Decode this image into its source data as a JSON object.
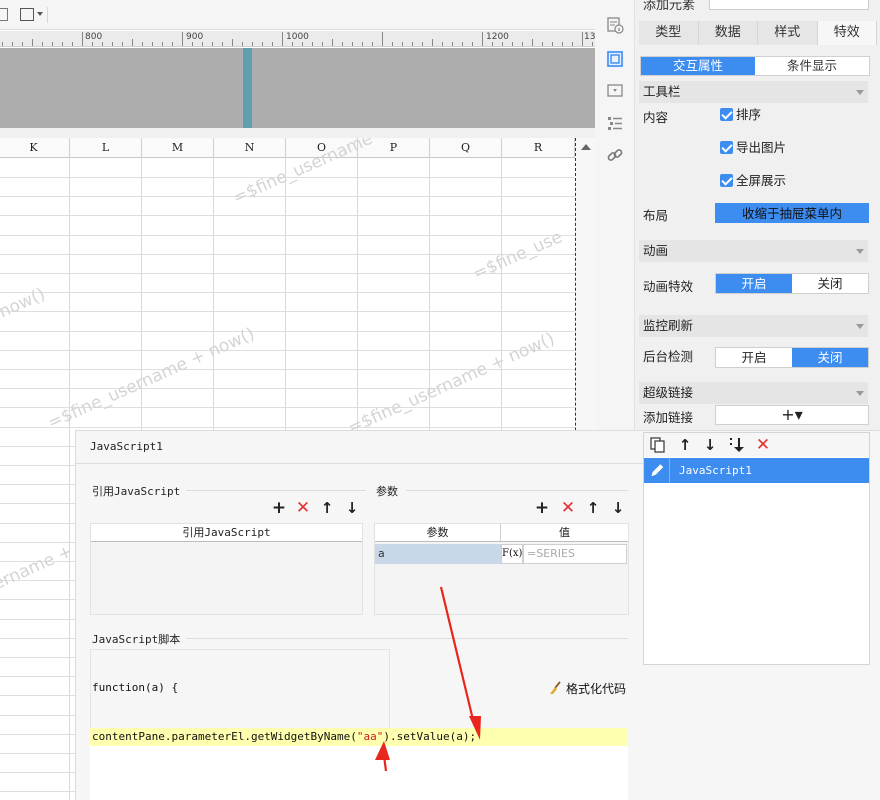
{
  "ruler": {
    "marks": [
      "800",
      "900",
      "1000",
      "1200",
      "13"
    ]
  },
  "sheet": {
    "columns": [
      "K",
      "L",
      "M",
      "N",
      "O",
      "P",
      "Q",
      "R"
    ],
    "watermark_text": "=$fine_username + now()",
    "watermarks": [
      "=$fine_username",
      "=$fine_use",
      "=$fine_username + now()",
      "=$fine_username + now()",
      "now()",
      "ername + now()"
    ]
  },
  "panel": {
    "add_element_label": "添加元素",
    "tabs": [
      "类型",
      "数据",
      "样式",
      "特效"
    ],
    "active_tab": "特效",
    "subtabs": [
      "交互属性",
      "条件显示"
    ],
    "active_subtab": "交互属性",
    "toolbar_section": {
      "title": "工具栏",
      "content_label": "内容",
      "checks": [
        "排序",
        "导出图片",
        "全屏展示"
      ],
      "layout_label": "布局",
      "layout_value": "收缩于抽屉菜单内"
    },
    "animation_section": {
      "title": "动画",
      "effect_label": "动画特效",
      "options": [
        "开启",
        "关闭"
      ],
      "selected": "开启"
    },
    "refresh_section": {
      "title": "监控刷新",
      "detect_label": "后台检测",
      "options": [
        "开启",
        "关闭"
      ],
      "selected": "关闭"
    },
    "hyperlink_section": {
      "title": "超级链接",
      "add_label": "添加链接",
      "add_symbol": "+▾"
    }
  },
  "script_list": {
    "items": [
      "JavaScript1"
    ],
    "selected": "JavaScript1"
  },
  "dialog": {
    "title": "JavaScript1",
    "ref_group": {
      "title": "引用JavaScript",
      "column": "引用JavaScript"
    },
    "param_group": {
      "title": "参数",
      "columns": [
        "参数",
        "值"
      ],
      "rows": [
        {
          "name": "a",
          "fx": "F(x)",
          "value": "=SERIES"
        }
      ]
    },
    "script_group": {
      "title": "JavaScript脚本",
      "code_line1": "function(a) {",
      "code_line2_pre": "contentPane.parameterEl.getWidgetByName(",
      "code_line2_str": "\"aa\"",
      "code_line2_post": ").setValue(a);",
      "format_button": "格式化代码"
    }
  },
  "colors": {
    "accent_blue": "#3d8cf0",
    "annotation_red": "#e8261c",
    "code_highlight": "#ffffb0"
  },
  "icons": [
    "grid-icon",
    "frame-icon",
    "widget-info-icon",
    "select-box-icon",
    "dropdown-icon",
    "list-icon",
    "link-icon",
    "copy-icon",
    "arrow-up-icon",
    "arrow-down-icon",
    "move-down-icon",
    "delete-icon",
    "pen-icon",
    "broom-icon"
  ]
}
